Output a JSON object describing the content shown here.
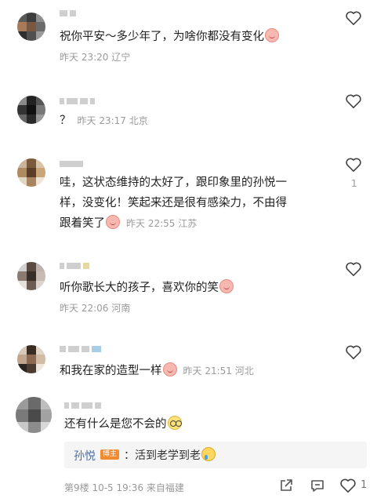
{
  "comments": [
    {
      "text": "祝你平安～多少年了，为啥你都没有变化",
      "meta": "昨天 23:20 辽宁"
    },
    {
      "text": "？",
      "meta": "昨天 23:17 北京"
    },
    {
      "line1": "哇，这状态维持的太好了，跟印象里的孙悦一",
      "line2": "样，没变化！笑起来还是很有感染力，不由得",
      "line3": "跟着笑了",
      "meta": "昨天 22:55 江苏",
      "likes": "1"
    },
    {
      "text": "听你歌长大的孩子，喜欢你的笑",
      "meta": "昨天 22:06 河南"
    },
    {
      "text": "和我在家的造型一样",
      "meta": "昨天 21:51 河北"
    },
    {
      "text": "还有什么是您不会的"
    }
  ],
  "reply": {
    "name": "孙悦",
    "tag": "博主",
    "text": "：活到老学到老"
  },
  "footer": {
    "meta": "第9楼 10-5 19:36 来自福建",
    "likes": "1"
  },
  "icons": {
    "like": "heart-outline-icon",
    "share": "share-icon",
    "comment": "comment-icon"
  }
}
